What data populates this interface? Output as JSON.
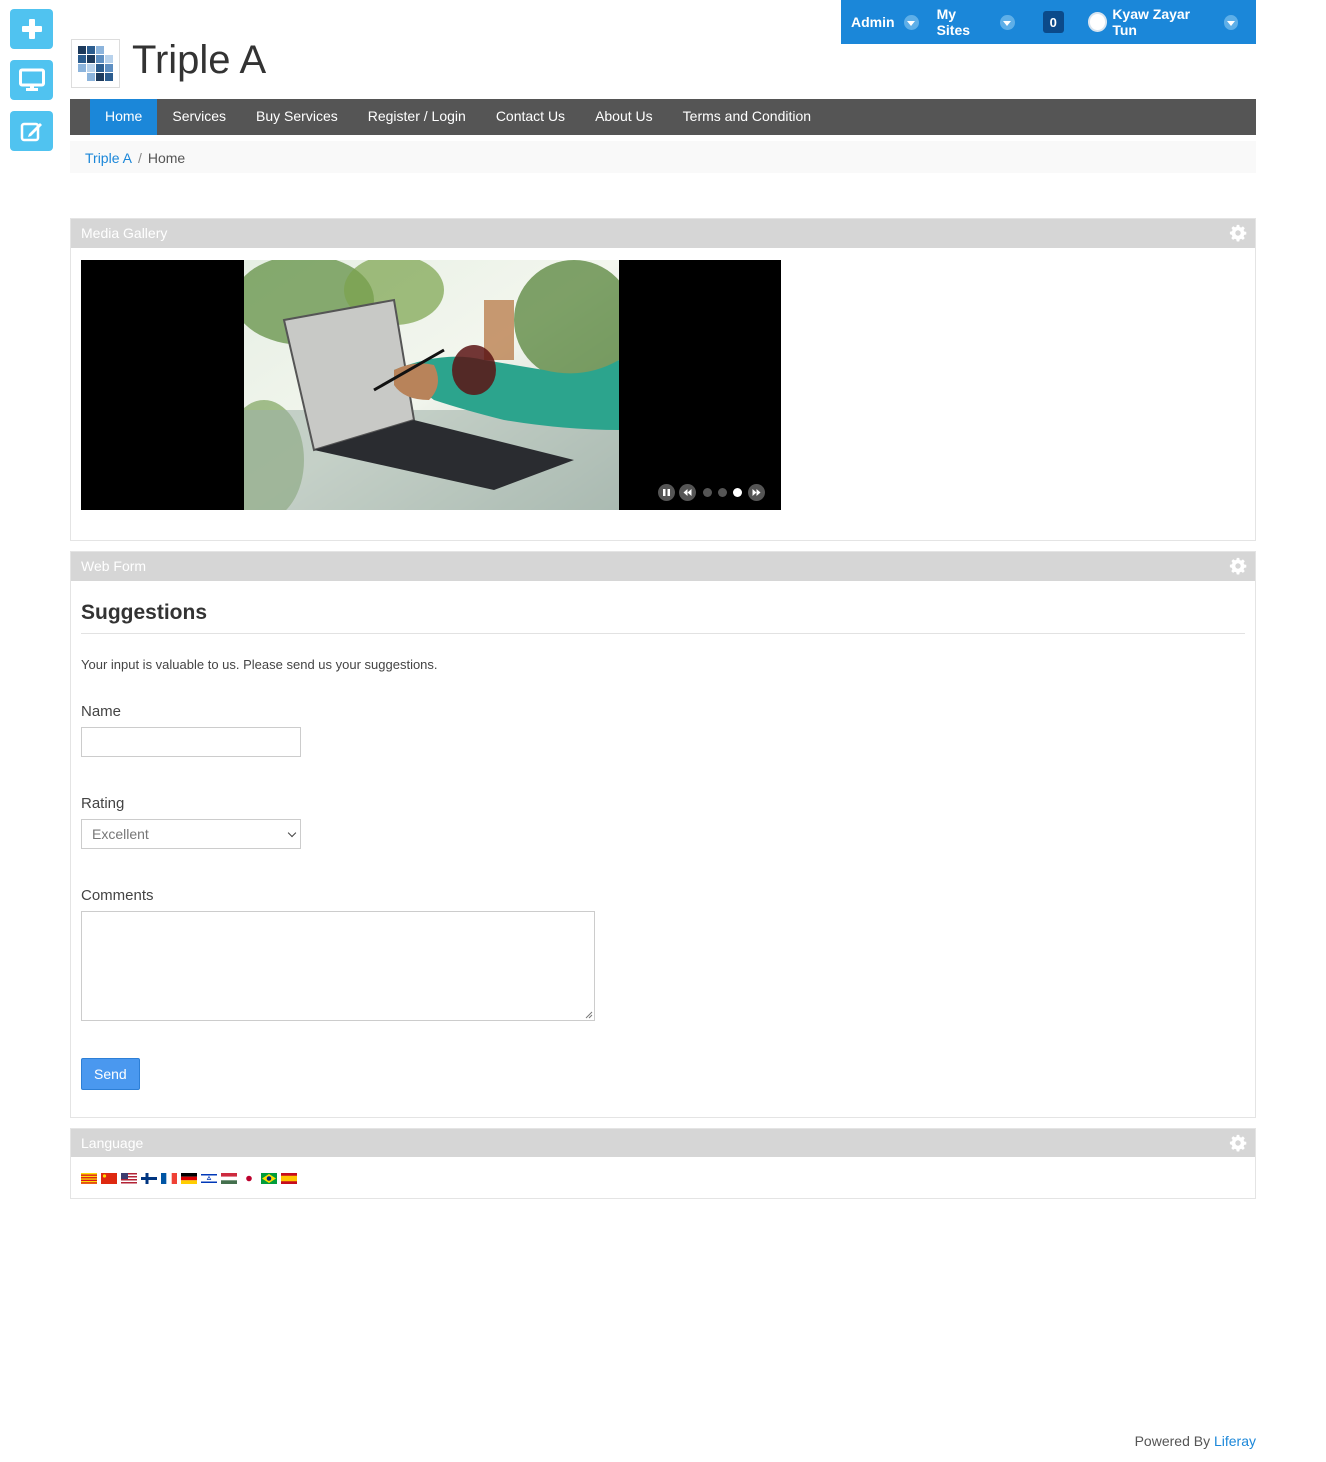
{
  "dock": {
    "add_icon": "plus-icon",
    "preview_icon": "desktop-icon",
    "edit_icon": "edit-icon"
  },
  "userbar": {
    "admin": "Admin",
    "my_sites": "My Sites",
    "notifications": "0",
    "user_name": "Kyaw Zayar Tun"
  },
  "site": {
    "title": "Triple A"
  },
  "nav": {
    "items": [
      "Home",
      "Services",
      "Buy Services",
      "Register / Login",
      "Contact Us",
      "About Us",
      "Terms and Condition"
    ],
    "active": "Home"
  },
  "breadcrumb": {
    "root": "Triple A",
    "separator": "/",
    "current": "Home"
  },
  "media_gallery": {
    "title": "Media Gallery",
    "slide_count": 3,
    "active_slide": 3
  },
  "web_form": {
    "title": "Web Form",
    "heading": "Suggestions",
    "description": "Your input is valuable to us. Please send us your suggestions.",
    "name_label": "Name",
    "name_value": "",
    "rating_label": "Rating",
    "rating_value": "Excellent",
    "comments_label": "Comments",
    "comments_value": "",
    "send_label": "Send"
  },
  "language": {
    "title": "Language",
    "flags": [
      "catalan",
      "chinese",
      "english-us",
      "finnish",
      "french",
      "german",
      "hebrew",
      "hungarian",
      "japanese",
      "portuguese-brazil",
      "spanish"
    ]
  },
  "footer": {
    "powered_by": "Powered By",
    "link": "Liferay"
  },
  "colors": {
    "primary": "#1b87d9",
    "dock": "#50c3f0",
    "nav": "#555555",
    "portlet_header": "#d6d6d6",
    "send_button": "#4a98ef"
  }
}
